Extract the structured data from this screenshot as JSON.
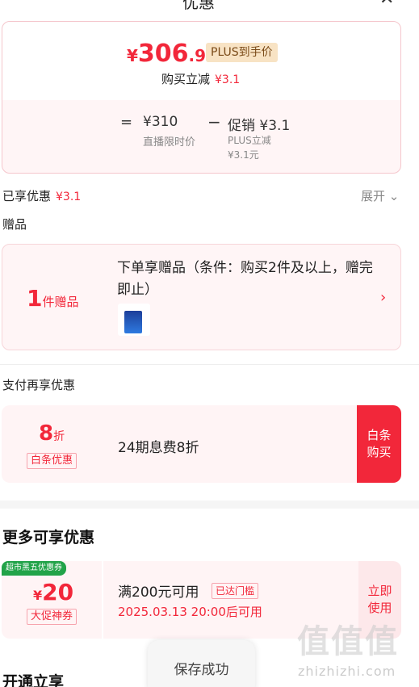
{
  "header": {
    "title": "优惠",
    "close_icon": "close-icon"
  },
  "price_card": {
    "currency": "¥",
    "price_int": "306",
    "price_dec": ".9",
    "plus_tag": "PLUS到手价",
    "buy_reduce_label": "购买立减",
    "buy_reduce_amount": "¥3.1",
    "equals": "=",
    "base_price": "¥310",
    "base_label": "直播限时价",
    "minus": "−",
    "promo_price": "促销 ¥3.1",
    "promo_label": "PLUS立减",
    "promo_sub": "¥3.1元"
  },
  "enjoyed": {
    "label": "已享优惠",
    "amount": "¥3.1",
    "expand": "展开 ⌄"
  },
  "gift_section": {
    "label": "赠品",
    "count": "1",
    "unit": "件赠品",
    "title": "下单享赠品（条件：购买2件及以上，赠完即止）",
    "arrow": "›"
  },
  "pay_section": {
    "label": "支付再享优惠",
    "discount": "8",
    "discount_unit": "折",
    "tag": "白条优惠",
    "desc": "24期息费8折",
    "button_line1": "白条",
    "button_line2": "购买"
  },
  "more_section": {
    "title": "更多可享优惠",
    "coupon": {
      "badge": "超市黑五优惠券",
      "currency": "¥",
      "value": "20",
      "tag": "大促神券",
      "condition": "满200元可用",
      "reached": "已达门槛",
      "time": "2025.03.13 20:00后可用",
      "button_line1": "立即",
      "button_line2": "使用"
    }
  },
  "open_section": {
    "title": "开通立享"
  },
  "toast": {
    "text": "保存成功"
  },
  "watermark": {
    "glyphs": "值值值",
    "site": "zhizhizhi.com"
  },
  "colors": {
    "accent": "#f2273a",
    "plus_tag_bg": "#f8e3c4",
    "coupon_badge": "#22a349"
  }
}
